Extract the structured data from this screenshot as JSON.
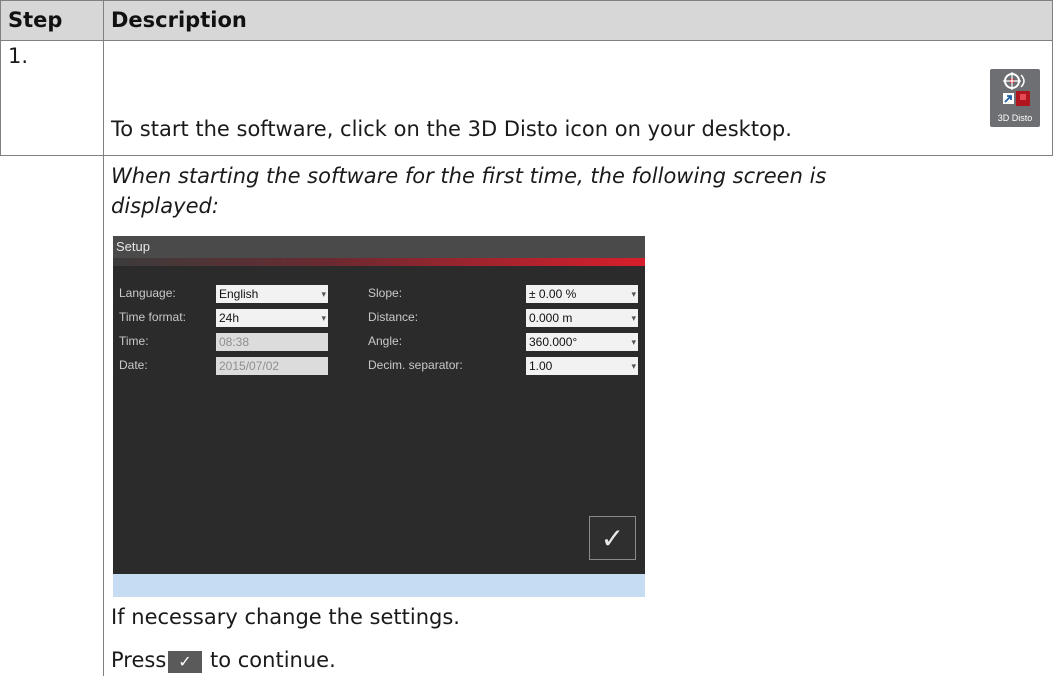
{
  "header": {
    "step": "Step",
    "description": "Description"
  },
  "rows": [
    {
      "step": "1.",
      "text": "To start the software, click on the 3D Disto icon on your desktop.",
      "icon": {
        "name": "3d-disto-app-icon",
        "label": "3D Disto"
      }
    },
    {
      "step": "",
      "note_line1": "When starting the software for the first time, the following screen is",
      "note_line2": "displayed:",
      "after1": "If necessary change the settings.",
      "after2_before": "Press",
      "after2_after": "to continue."
    }
  ],
  "setup_screen": {
    "title": "Setup",
    "fields": {
      "language": {
        "label": "Language:",
        "value": "English"
      },
      "time_format": {
        "label": "Time format:",
        "value": "24h"
      },
      "time": {
        "label": "Time:",
        "value": "08:38"
      },
      "date": {
        "label": "Date:",
        "value": "2015/07/02"
      },
      "slope": {
        "label": "Slope:",
        "value": "± 0.00 %"
      },
      "distance": {
        "label": "Distance:",
        "value": "0.000 m"
      },
      "angle": {
        "label": "Angle:",
        "value": "360.000°"
      },
      "decim_separator": {
        "label": "Decim. separator:",
        "value": "1.00"
      }
    },
    "ok_symbol": "✓"
  },
  "colors": {
    "header_bg": "#d7d7d7",
    "setup_bg": "#2b2b2b",
    "accent_red": "#d81e2c",
    "status_bar": "#c5dcf2"
  }
}
